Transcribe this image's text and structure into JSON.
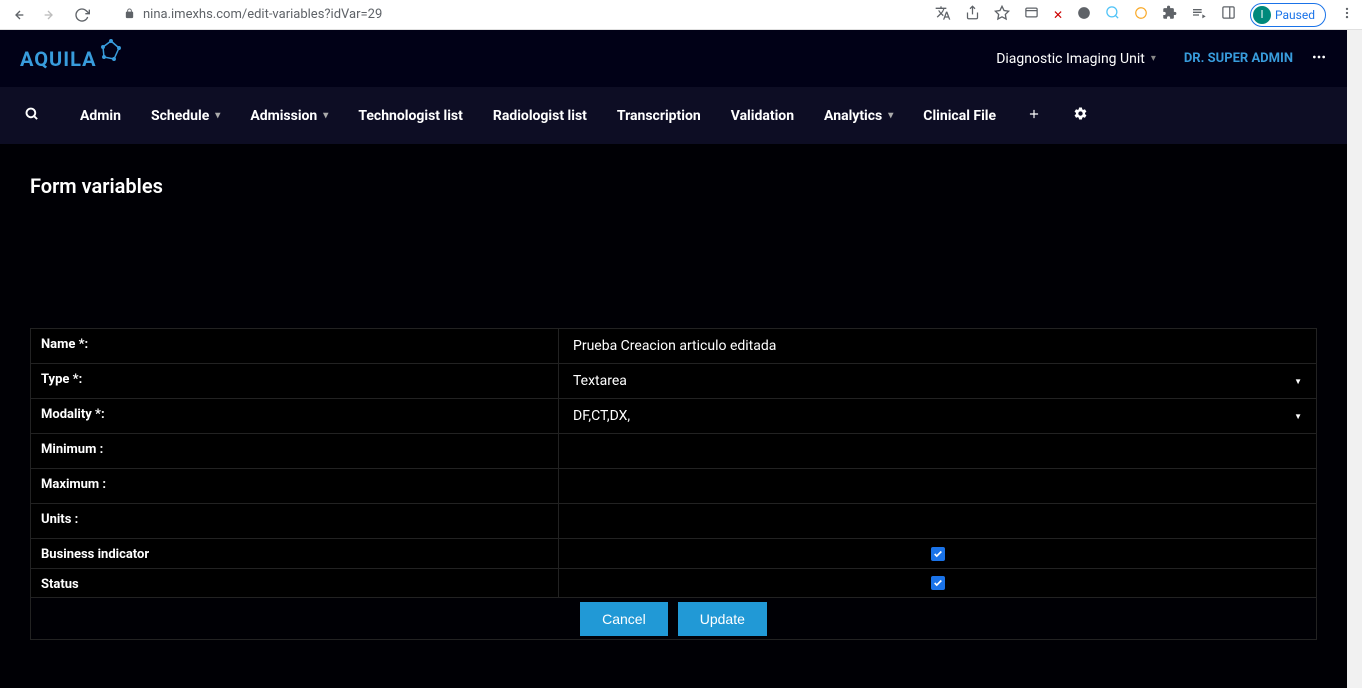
{
  "browser": {
    "url": "nina.imexhs.com/edit-variables?idVar=29",
    "profile_letter": "I",
    "profile_state": "Paused"
  },
  "header": {
    "org": "Diagnostic Imaging Unit",
    "user": "DR. SUPER ADMIN"
  },
  "nav": {
    "admin": "Admin",
    "schedule": "Schedule",
    "admission": "Admission",
    "technologist": "Technologist list",
    "radiologist": "Radiologist list",
    "transcription": "Transcription",
    "validation": "Validation",
    "analytics": "Analytics",
    "clinical": "Clinical File"
  },
  "page_title": "Form variables",
  "form": {
    "labels": {
      "name": "Name *:",
      "type": "Type *:",
      "modality": "Modality *:",
      "minimum": "Minimum :",
      "maximum": "Maximum :",
      "units": "Units :",
      "business_indicator": "Business indicator",
      "status": "Status"
    },
    "values": {
      "name": "Prueba Creacion articulo editada",
      "type": "Textarea",
      "modality": "DF,CT,DX,",
      "minimum": "",
      "maximum": "",
      "units": "",
      "business_indicator": true,
      "status": true
    }
  },
  "buttons": {
    "cancel": "Cancel",
    "update": "Update"
  }
}
